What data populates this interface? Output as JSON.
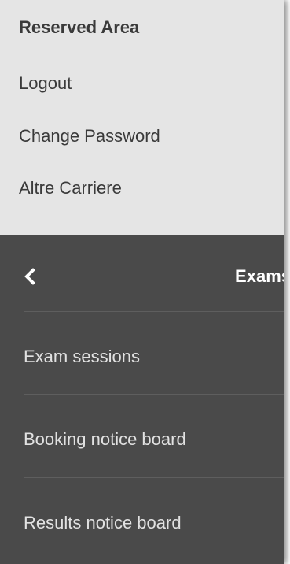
{
  "reserved_area": {
    "title": "Reserved Area",
    "links": [
      {
        "label": "Logout"
      },
      {
        "label": "Change Password"
      },
      {
        "label": "Altre Carriere"
      }
    ]
  },
  "exams_menu": {
    "back_icon": "chevron-left-icon",
    "title": "Exams",
    "items": [
      {
        "label": "Exam sessions"
      },
      {
        "label": "Booking notice board"
      },
      {
        "label": "Results notice board"
      }
    ]
  },
  "colors": {
    "reserved_bg": "#e5e5e5",
    "reserved_text": "#3a3a3a",
    "menu_bg": "#4a4a4a",
    "menu_text": "#e2e2e2",
    "divider": "#5e5e5e"
  }
}
